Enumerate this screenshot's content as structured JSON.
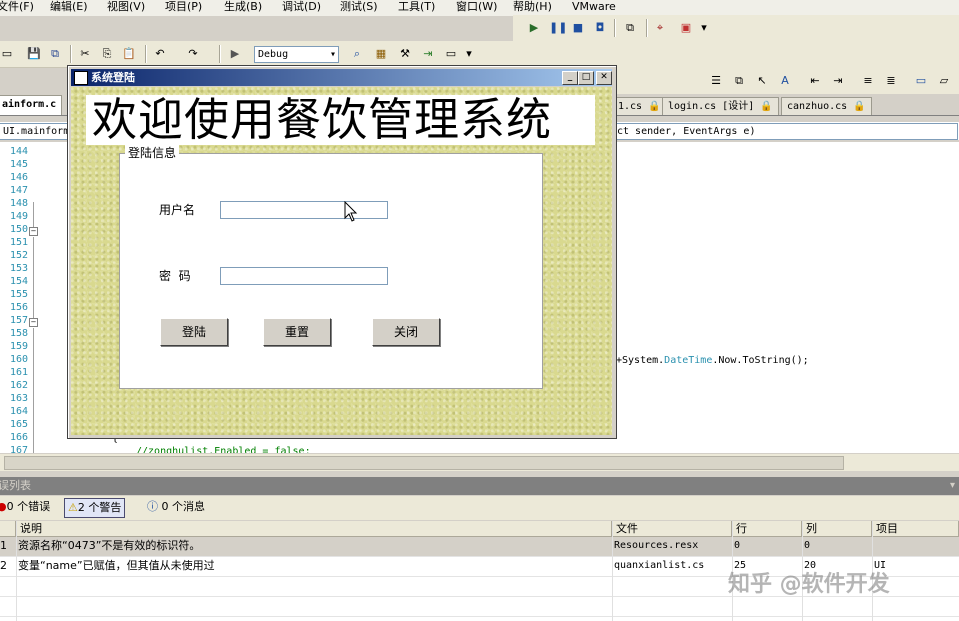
{
  "menubar": {
    "items": [
      "文件(F)",
      "编辑(E)",
      "视图(V)",
      "项目(P)",
      "生成(B)",
      "调试(D)",
      "测试(S)",
      "工具(T)",
      "窗口(W)",
      "帮助(H)",
      "VMware"
    ]
  },
  "toolbar": {
    "config_combo": "Debug"
  },
  "tabs": [
    {
      "label": "ainform.c",
      "active": true
    },
    {
      "label": "1.cs 🔒",
      "active": false
    },
    {
      "label": "login.cs [设计] 🔒",
      "active": false
    },
    {
      "label": "canzhuo.cs 🔒",
      "active": false
    }
  ],
  "nav": {
    "left_combo": "UI.mainform",
    "right_combo": "ct sender, EventArgs e)"
  },
  "editor": {
    "line_numbers": [
      "144",
      "145",
      "146",
      "147",
      "148",
      "149",
      "150",
      "151",
      "152",
      "153",
      "154",
      "155",
      "156",
      "157",
      "158",
      "159",
      "160",
      "161",
      "162",
      "163",
      "164",
      "165",
      "166",
      "167"
    ],
    "code_fragment_1": "+System.",
    "code_fragment_type": "DateTime",
    "code_fragment_2": ".Now.ToString();",
    "brace_line": "{",
    "bottom_line": "//zonghulist.Enabled = false;"
  },
  "dialog": {
    "title": "系统登陆",
    "banner": "欢迎使用餐饮管理系统",
    "group_title": "登陆信息",
    "username_label": "用户名",
    "password_label": "密  码",
    "username_value": "",
    "password_value": "",
    "login_button": "登陆",
    "reset_button": "重置",
    "close_button": "关闭"
  },
  "error_list": {
    "header": "误列表",
    "errors_filter": "0 个错误",
    "warnings_filter": "2 个警告",
    "messages_filter": "0 个消息",
    "columns": [
      "说明",
      "文件",
      "行",
      "列",
      "项目"
    ],
    "rows": [
      {
        "num": "1",
        "desc": "资源名称“0473”不是有效的标识符。",
        "file": "Resources.resx",
        "line": "0",
        "col": "0",
        "project": ""
      },
      {
        "num": "2",
        "desc": "变量“name”已赋值，但其值从未使用过",
        "file": "quanxianlist.cs",
        "line": "25",
        "col": "20",
        "project": "UI"
      }
    ]
  },
  "watermark": "知乎 @软件开发"
}
